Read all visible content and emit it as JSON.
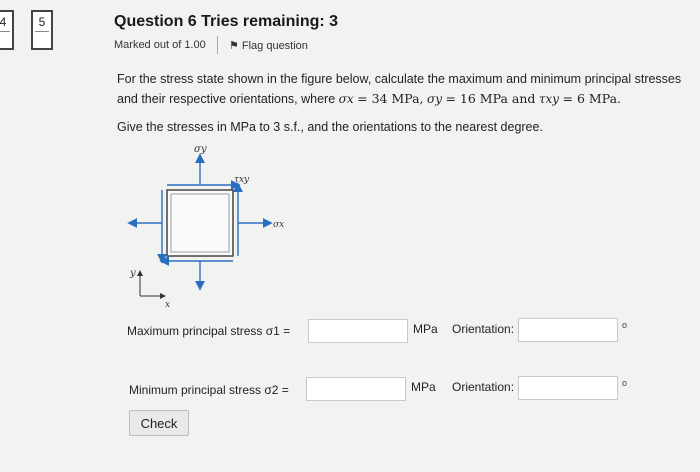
{
  "nav": {
    "prev_number": "4",
    "current_number": "5"
  },
  "question": {
    "title": "Question 6 Tries remaining: 3",
    "marked": "Marked out of 1.00",
    "flag_label": "Flag question"
  },
  "text": {
    "line1": "For the stress state shown in the figure below, calculate the maximum and minimum principal stresses",
    "line2_prefix": "and their respective orientations, where",
    "sx_sym": "σx",
    "sx_val": "= 34 MPa,",
    "sy_sym": "σy",
    "sy_val": "= 16 MPa and",
    "txy_sym": "τxy",
    "txy_val": "= 6 MPa.",
    "instruction": "Give the stresses in MPa to 3 s.f., and the orientations to the nearest degree."
  },
  "diagram": {
    "sigma_y": "σy",
    "tau_xy": "τxy",
    "sigma_x": "σx",
    "axis_y": "y",
    "axis_x": "x"
  },
  "answers": {
    "max_label": "Maximum principal stress σ1 =",
    "min_label": "Minimum principal stress σ2 =",
    "unit": "MPa",
    "orientation_label": "Orientation:",
    "degree": "o",
    "max_value": "",
    "min_value": "",
    "max_orientation": "",
    "min_orientation": ""
  },
  "check_label": "Check",
  "colors": {
    "arrow": "#2a6fbf",
    "box_border": "#444"
  }
}
